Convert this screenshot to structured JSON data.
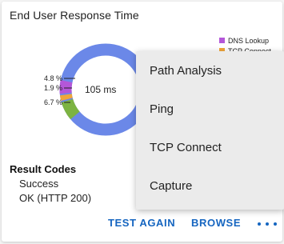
{
  "card": {
    "title": "End User Response Time",
    "center_value": "105 ms"
  },
  "chart_data": {
    "type": "pie",
    "variant": "donut",
    "center_label": "105 ms",
    "slices_percent": [
      {
        "label": "4.8 %",
        "value": 4.8,
        "color": "#b457d9"
      },
      {
        "label": "1.9 %",
        "value": 1.9,
        "color": "#f0a63b"
      },
      {
        "label": "6.7 %",
        "value": 6.7,
        "color": "#7cb342"
      }
    ],
    "other_color": "#6b88e8",
    "legend": [
      {
        "name": "DNS Lookup",
        "color": "#b457d9"
      },
      {
        "name": "TCP Connect",
        "color": "#f0a63b"
      }
    ]
  },
  "results": {
    "heading": "Result Codes",
    "status": "Success",
    "http": "OK (HTTP 200)"
  },
  "actions": {
    "test_again": "TEST AGAIN",
    "browse": "BROWSE",
    "more": "more-vert-icon"
  },
  "menu": {
    "items": [
      {
        "label": "Path Analysis"
      },
      {
        "label": "Ping"
      },
      {
        "label": "TCP Connect"
      },
      {
        "label": "Capture"
      }
    ]
  },
  "colors": {
    "accent": "#1565c0",
    "menu_bg": "#ebebeb"
  }
}
